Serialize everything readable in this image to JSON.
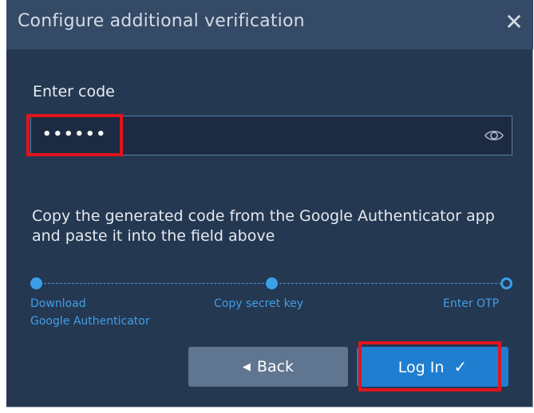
{
  "dialog": {
    "title": "Configure additional verification",
    "close_glyph": "✕"
  },
  "code": {
    "label": "Enter code",
    "value": "••••••"
  },
  "instructions": "Copy the generated code from the Google Authenticator app and paste it into the field above",
  "steps": [
    {
      "label_line1": "Download",
      "label_line2": "Google Authenticator",
      "state": "done"
    },
    {
      "label_line1": "Copy secret key",
      "state": "done"
    },
    {
      "label_line1": "Enter OTP",
      "state": "current"
    }
  ],
  "buttons": {
    "back_icon": "◀",
    "back_label": "Back",
    "login_label": "Log In",
    "login_icon": "✓"
  },
  "colors": {
    "dialog_bg": "#253851",
    "titlebar_bg": "#344a66",
    "accent": "#3aa0e8",
    "login_bg": "#1f7ed0",
    "back_bg": "#60758f",
    "highlight": "#e0141c"
  },
  "icons": {
    "close": "close-icon",
    "password_visibility": "eye-icon",
    "back": "caret-left-icon",
    "login": "checkmark-icon"
  }
}
